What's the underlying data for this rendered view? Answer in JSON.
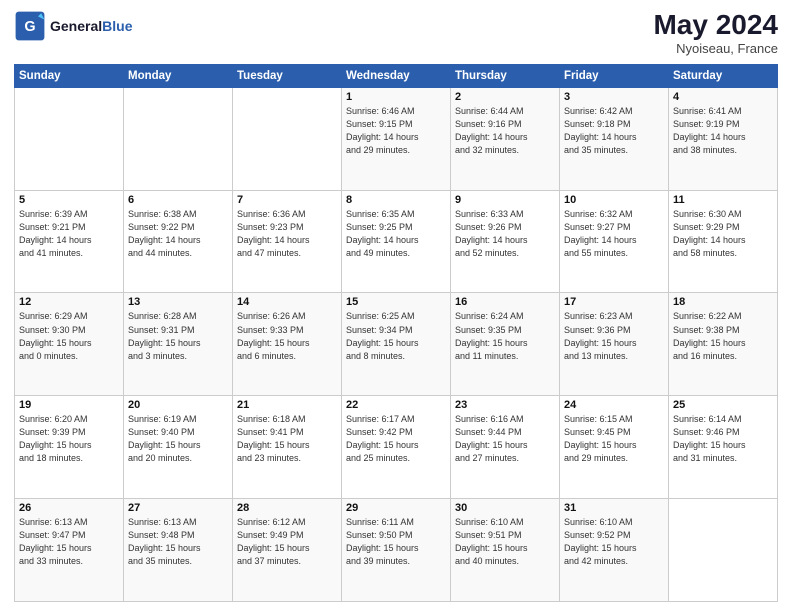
{
  "header": {
    "logo_text_general": "General",
    "logo_text_blue": "Blue",
    "month_year": "May 2024",
    "location": "Nyoiseau, France"
  },
  "days_of_week": [
    "Sunday",
    "Monday",
    "Tuesday",
    "Wednesday",
    "Thursday",
    "Friday",
    "Saturday"
  ],
  "weeks": [
    [
      {
        "day": "",
        "info": ""
      },
      {
        "day": "",
        "info": ""
      },
      {
        "day": "",
        "info": ""
      },
      {
        "day": "1",
        "info": "Sunrise: 6:46 AM\nSunset: 9:15 PM\nDaylight: 14 hours\nand 29 minutes."
      },
      {
        "day": "2",
        "info": "Sunrise: 6:44 AM\nSunset: 9:16 PM\nDaylight: 14 hours\nand 32 minutes."
      },
      {
        "day": "3",
        "info": "Sunrise: 6:42 AM\nSunset: 9:18 PM\nDaylight: 14 hours\nand 35 minutes."
      },
      {
        "day": "4",
        "info": "Sunrise: 6:41 AM\nSunset: 9:19 PM\nDaylight: 14 hours\nand 38 minutes."
      }
    ],
    [
      {
        "day": "5",
        "info": "Sunrise: 6:39 AM\nSunset: 9:21 PM\nDaylight: 14 hours\nand 41 minutes."
      },
      {
        "day": "6",
        "info": "Sunrise: 6:38 AM\nSunset: 9:22 PM\nDaylight: 14 hours\nand 44 minutes."
      },
      {
        "day": "7",
        "info": "Sunrise: 6:36 AM\nSunset: 9:23 PM\nDaylight: 14 hours\nand 47 minutes."
      },
      {
        "day": "8",
        "info": "Sunrise: 6:35 AM\nSunset: 9:25 PM\nDaylight: 14 hours\nand 49 minutes."
      },
      {
        "day": "9",
        "info": "Sunrise: 6:33 AM\nSunset: 9:26 PM\nDaylight: 14 hours\nand 52 minutes."
      },
      {
        "day": "10",
        "info": "Sunrise: 6:32 AM\nSunset: 9:27 PM\nDaylight: 14 hours\nand 55 minutes."
      },
      {
        "day": "11",
        "info": "Sunrise: 6:30 AM\nSunset: 9:29 PM\nDaylight: 14 hours\nand 58 minutes."
      }
    ],
    [
      {
        "day": "12",
        "info": "Sunrise: 6:29 AM\nSunset: 9:30 PM\nDaylight: 15 hours\nand 0 minutes."
      },
      {
        "day": "13",
        "info": "Sunrise: 6:28 AM\nSunset: 9:31 PM\nDaylight: 15 hours\nand 3 minutes."
      },
      {
        "day": "14",
        "info": "Sunrise: 6:26 AM\nSunset: 9:33 PM\nDaylight: 15 hours\nand 6 minutes."
      },
      {
        "day": "15",
        "info": "Sunrise: 6:25 AM\nSunset: 9:34 PM\nDaylight: 15 hours\nand 8 minutes."
      },
      {
        "day": "16",
        "info": "Sunrise: 6:24 AM\nSunset: 9:35 PM\nDaylight: 15 hours\nand 11 minutes."
      },
      {
        "day": "17",
        "info": "Sunrise: 6:23 AM\nSunset: 9:36 PM\nDaylight: 15 hours\nand 13 minutes."
      },
      {
        "day": "18",
        "info": "Sunrise: 6:22 AM\nSunset: 9:38 PM\nDaylight: 15 hours\nand 16 minutes."
      }
    ],
    [
      {
        "day": "19",
        "info": "Sunrise: 6:20 AM\nSunset: 9:39 PM\nDaylight: 15 hours\nand 18 minutes."
      },
      {
        "day": "20",
        "info": "Sunrise: 6:19 AM\nSunset: 9:40 PM\nDaylight: 15 hours\nand 20 minutes."
      },
      {
        "day": "21",
        "info": "Sunrise: 6:18 AM\nSunset: 9:41 PM\nDaylight: 15 hours\nand 23 minutes."
      },
      {
        "day": "22",
        "info": "Sunrise: 6:17 AM\nSunset: 9:42 PM\nDaylight: 15 hours\nand 25 minutes."
      },
      {
        "day": "23",
        "info": "Sunrise: 6:16 AM\nSunset: 9:44 PM\nDaylight: 15 hours\nand 27 minutes."
      },
      {
        "day": "24",
        "info": "Sunrise: 6:15 AM\nSunset: 9:45 PM\nDaylight: 15 hours\nand 29 minutes."
      },
      {
        "day": "25",
        "info": "Sunrise: 6:14 AM\nSunset: 9:46 PM\nDaylight: 15 hours\nand 31 minutes."
      }
    ],
    [
      {
        "day": "26",
        "info": "Sunrise: 6:13 AM\nSunset: 9:47 PM\nDaylight: 15 hours\nand 33 minutes."
      },
      {
        "day": "27",
        "info": "Sunrise: 6:13 AM\nSunset: 9:48 PM\nDaylight: 15 hours\nand 35 minutes."
      },
      {
        "day": "28",
        "info": "Sunrise: 6:12 AM\nSunset: 9:49 PM\nDaylight: 15 hours\nand 37 minutes."
      },
      {
        "day": "29",
        "info": "Sunrise: 6:11 AM\nSunset: 9:50 PM\nDaylight: 15 hours\nand 39 minutes."
      },
      {
        "day": "30",
        "info": "Sunrise: 6:10 AM\nSunset: 9:51 PM\nDaylight: 15 hours\nand 40 minutes."
      },
      {
        "day": "31",
        "info": "Sunrise: 6:10 AM\nSunset: 9:52 PM\nDaylight: 15 hours\nand 42 minutes."
      },
      {
        "day": "",
        "info": ""
      }
    ]
  ]
}
